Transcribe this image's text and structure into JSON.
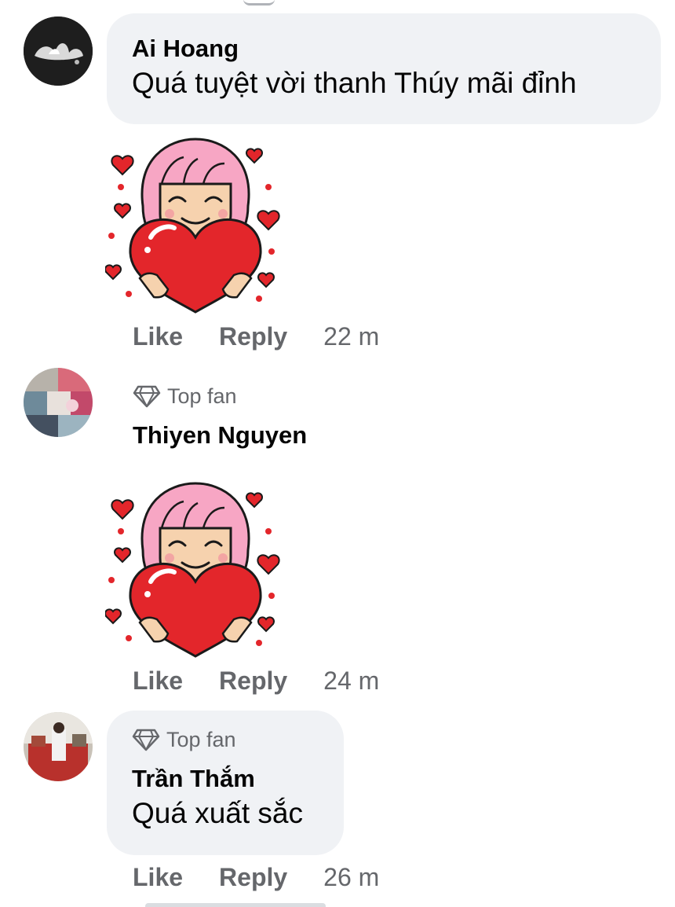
{
  "comments": [
    {
      "author": "Ai Hoang",
      "text": "Quá tuyệt vời thanh Thúy mãi đỉnh",
      "badge": "",
      "sticker": "heart-girl-sticker",
      "actions": {
        "like": "Like",
        "reply": "Reply",
        "time": "22 m"
      }
    },
    {
      "author": "Thiyen Nguyen",
      "text": "",
      "badge": "Top fan",
      "sticker": "heart-girl-sticker",
      "actions": {
        "like": "Like",
        "reply": "Reply",
        "time": "24 m"
      }
    },
    {
      "author": "Trần Thắm",
      "text": "Quá xuất sắc",
      "badge": "Top fan",
      "sticker": "",
      "actions": {
        "like": "Like",
        "reply": "Reply",
        "time": "26 m"
      }
    }
  ],
  "colors": {
    "bubble_bg": "#f0f2f5",
    "meta_text": "#65676b",
    "heart_red": "#e3262b",
    "hair_pink": "#f7a6c4"
  },
  "icons": {
    "top_fan": "diamond-icon"
  }
}
